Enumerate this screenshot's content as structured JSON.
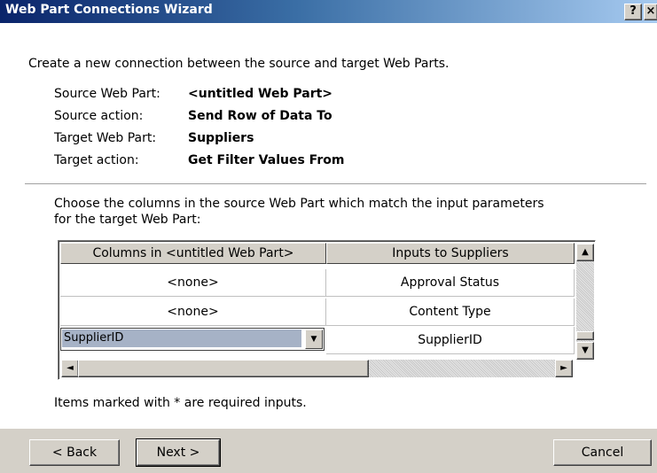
{
  "window": {
    "title": "Web Part Connections Wizard",
    "help_label": "?",
    "close_label": "×"
  },
  "intro": "Create a new connection between the source and target Web Parts.",
  "info": [
    {
      "label": "Source Web Part:",
      "value": "<untitled Web Part>"
    },
    {
      "label": "Source action:",
      "value": "Send Row of Data To"
    },
    {
      "label": "Target Web Part:",
      "value": "Suppliers"
    },
    {
      "label": "Target action:",
      "value": "Get Filter Values From"
    }
  ],
  "instructions_line1": "Choose the columns in the source Web Part which match the input parameters",
  "instructions_line2": "for the target Web Part:",
  "grid": {
    "headers": [
      "Columns in <untitled Web Part>",
      "Inputs to Suppliers"
    ],
    "rows": [
      {
        "source": "<none>",
        "target": "Approval Status"
      },
      {
        "source": "<none>",
        "target": "Content Type"
      },
      {
        "source": "SupplierID",
        "target": "SupplierID"
      }
    ]
  },
  "required_note": "Items marked with * are required inputs.",
  "buttons": {
    "back": "< Back",
    "next": "Next >",
    "cancel": "Cancel"
  },
  "icons": {
    "scroll_up": "▲",
    "scroll_down": "▼",
    "scroll_left": "◄",
    "scroll_right": "►",
    "dropdown": "▼"
  }
}
